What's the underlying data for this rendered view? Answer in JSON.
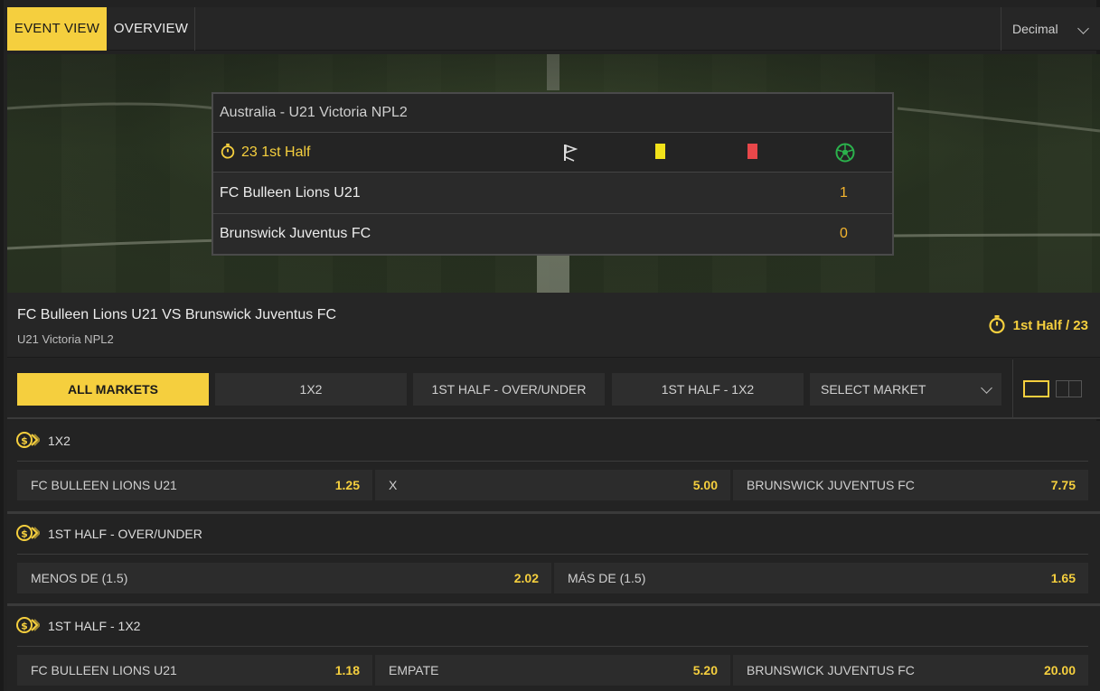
{
  "tabs": {
    "event_view": "EVENT VIEW",
    "overview": "OVERVIEW"
  },
  "odds_format": {
    "selected": "Decimal"
  },
  "scoreboard": {
    "league": "Australia - U21 Victoria NPL2",
    "clock": "23 1st Half",
    "home_team": "FC Bulleen Lions U21",
    "home_score": "1",
    "away_team": "Brunswick Juventus FC",
    "away_score": "0",
    "stat_icons": [
      "corner-flag-icon",
      "yellow-card-icon",
      "red-card-icon",
      "soccer-ball-icon"
    ]
  },
  "match": {
    "title": "FC Bulleen Lions U21 VS Brunswick Juventus FC",
    "competition": "U21 Victoria NPL2",
    "time": "1st Half / 23"
  },
  "market_tabs": [
    {
      "label": "ALL MARKETS"
    },
    {
      "label": "1X2"
    },
    {
      "label": "1ST HALF - OVER/UNDER"
    },
    {
      "label": "1ST HALF - 1X2"
    },
    {
      "label": "SELECT MARKET"
    }
  ],
  "markets": [
    {
      "name": "1X2",
      "selections": [
        {
          "label": "FC BULLEEN LIONS U21",
          "odd": "1.25"
        },
        {
          "label": "X",
          "odd": "5.00"
        },
        {
          "label": "BRUNSWICK JUVENTUS FC",
          "odd": "7.75"
        }
      ]
    },
    {
      "name": "1ST HALF - OVER/UNDER",
      "selections": [
        {
          "label": "MENOS DE (1.5)",
          "odd": "2.02"
        },
        {
          "label": "MÁS DE (1.5)",
          "odd": "1.65"
        }
      ]
    },
    {
      "name": "1ST HALF - 1X2",
      "selections": [
        {
          "label": "FC BULLEEN LIONS U21",
          "odd": "1.18"
        },
        {
          "label": "EMPATE",
          "odd": "5.20"
        },
        {
          "label": "BRUNSWICK JUVENTUS FC",
          "odd": "20.00"
        }
      ]
    }
  ],
  "colors": {
    "accent": "#f5cf3e",
    "score": "#f5b52e",
    "background": "#222222"
  }
}
